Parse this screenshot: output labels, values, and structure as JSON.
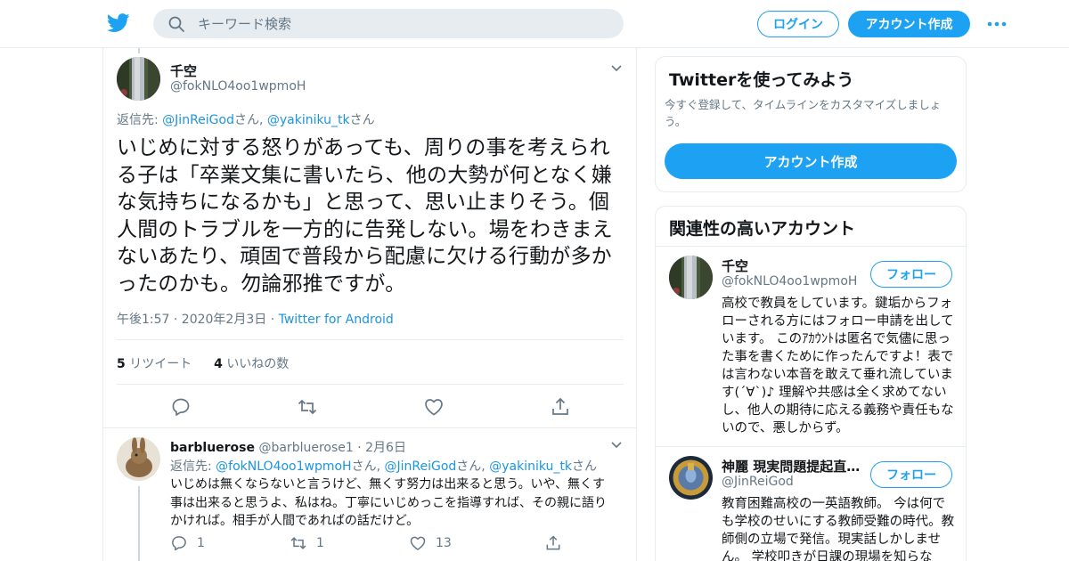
{
  "header": {
    "search_placeholder": "キーワード検索",
    "login_label": "ログイン",
    "signup_label": "アカウント作成",
    "brand_color": "#1da1f2"
  },
  "main_tweet": {
    "name": "千空",
    "handle": "@fokNLO4oo1wpmoH",
    "reply_prefix": "返信先: ",
    "reply_users": [
      "@JinReiGod",
      "@yakiniku_tk"
    ],
    "reply_suffix": "さん",
    "reply_separator": ", ",
    "text": "いじめに対する怒りがあっても、周りの事を考えられる子は「卒業文集に書いたら、他の大勢が何となく嫌な気持ちになるかも」と思って、思い止まりそう。個人間のトラブルを一方的に告発しない。場をわきまえないあたり、頑固で普段から配慮に欠ける行動が多かったのかも。勿論邪推ですが。",
    "time": "午後1:57 · 2020年2月3日",
    "dot": "·",
    "source": "Twitter for Android",
    "retweets_count": "5",
    "retweets_label": "リツイート",
    "likes_count": "4",
    "likes_label": "いいねの数"
  },
  "reply_tweet": {
    "name": "barbluerose",
    "handle": "@barbluerose1",
    "date": "· 2月6日",
    "reply_prefix": "返信先: ",
    "reply_users": [
      "@fokNLO4oo1wpmoH",
      "@JinReiGod",
      "@yakiniku_tk"
    ],
    "reply_suffix": "さん",
    "text": "いじめは無くならないと言うけど、無くす努力は出来ると思う。いや、無くす事は出来ると思うよ、私はね。丁寧にいじめっこを指導すれば、その親に語りかければ。相手が人間であればの話だけど。",
    "reply_count": "1",
    "retweet_count": "1",
    "like_count": "13"
  },
  "signup_card": {
    "title": "Twitterを使ってみよう",
    "desc": "今すぐ登録して、タイムラインをカスタマイズしましょう。",
    "cta": "アカウント作成"
  },
  "related": {
    "title": "関連性の高いアカウント",
    "follow_label": "フォロー",
    "accounts": [
      {
        "name": "千空",
        "handle": "@fokNLO4oo1wpmoH",
        "bio": "高校で教員をしています。鍵垢からフォローされる方にはフォロー申請を出しています。 このｱｶｳﾝﾄは匿名で気儘に思った事を書くために作ったんですよ！表では言わない本音を敢えて垂れ流しています(´∀`)♪ 理解や共感は全く求めてないし、他人の期待に応える義務や責任もないので、悪しからず。"
      },
      {
        "name": "神麗 現実問題提起直…",
        "handle": "@JinReiGod",
        "bio": "教育困難高校の一英語教師。 今は何でも学校のせいにする教師受難の時代。教師側の立場で発信。現実話しかしません。 学校叩きが日課の現場を知らな"
      }
    ]
  }
}
